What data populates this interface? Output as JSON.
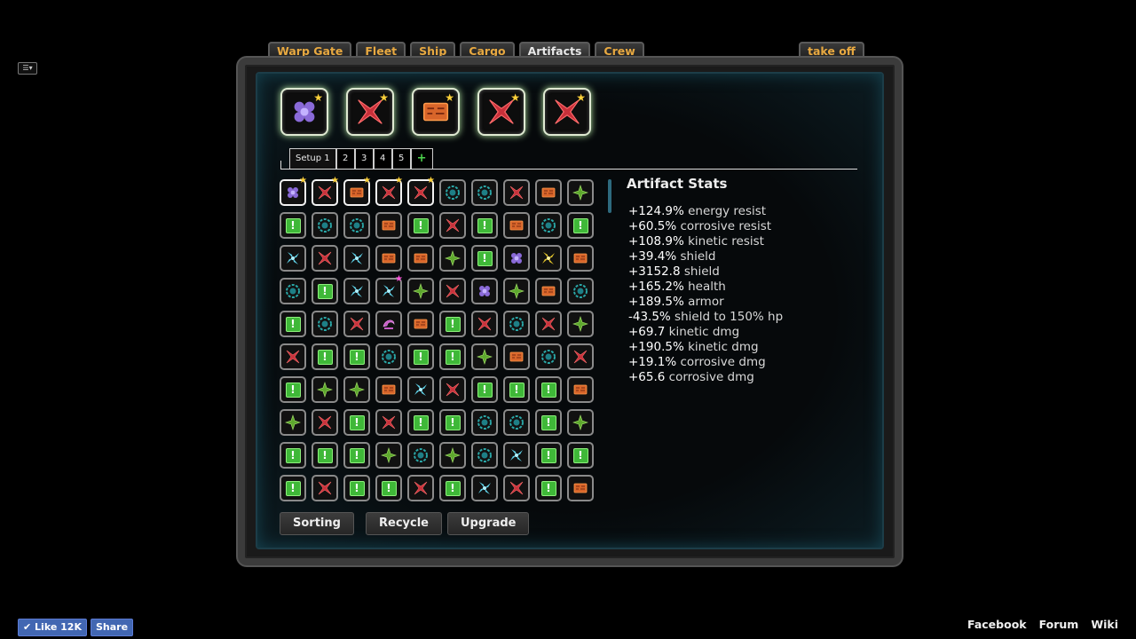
{
  "menu_icon": "menu-dropdown-icon",
  "tabs": [
    {
      "label": "Warp Gate",
      "active": false
    },
    {
      "label": "Fleet",
      "active": false
    },
    {
      "label": "Ship",
      "active": false
    },
    {
      "label": "Cargo",
      "active": false
    },
    {
      "label": "Artifacts",
      "active": true
    },
    {
      "label": "Crew",
      "active": false
    }
  ],
  "takeoff_label": "take off",
  "equipped": [
    "purple-hex",
    "red-x",
    "orange-chip",
    "red-x",
    "red-x"
  ],
  "setups": [
    {
      "label": "Setup 1",
      "active": true
    },
    {
      "label": "2",
      "active": false
    },
    {
      "label": "3",
      "active": false
    },
    {
      "label": "4",
      "active": false
    },
    {
      "label": "5",
      "active": false
    }
  ],
  "add_setup_label": "+",
  "grid": [
    [
      "purple-hex*",
      "red-x*",
      "orange-chip*",
      "red-x*",
      "red-x*",
      "teal-gear",
      "teal-gear",
      "red-x",
      "orange-chip",
      "green-leaf"
    ],
    [
      "green-box",
      "teal-gear",
      "teal-gear",
      "orange-chip",
      "green-box",
      "red-x",
      "green-box",
      "orange-chip",
      "teal-gear",
      "green-box"
    ],
    [
      "cyan-fan",
      "red-x",
      "cyan-fan",
      "orange-chip",
      "orange-chip",
      "green-leaf",
      "green-box",
      "purple-hex",
      "yellow-fan",
      "orange-chip"
    ],
    [
      "teal-gear",
      "green-box",
      "cyan-fan",
      "cyan-fan!",
      "green-leaf",
      "red-x",
      "purple-hex",
      "green-leaf",
      "orange-chip",
      "teal-gear"
    ],
    [
      "green-box",
      "teal-gear",
      "red-x",
      "pink-claw",
      "orange-chip",
      "green-box",
      "red-x",
      "teal-gear",
      "red-x",
      "green-leaf"
    ],
    [
      "red-x",
      "green-box",
      "green-box",
      "teal-gear",
      "green-box",
      "green-box",
      "green-leaf",
      "orange-chip",
      "teal-gear",
      "red-x"
    ],
    [
      "green-box",
      "green-leaf",
      "green-leaf",
      "orange-chip",
      "cyan-fan",
      "red-x",
      "green-box",
      "green-box",
      "green-box",
      "orange-chip"
    ],
    [
      "green-leaf",
      "red-x",
      "green-box",
      "red-x",
      "green-box",
      "green-box",
      "teal-gear",
      "teal-gear",
      "green-box",
      "green-leaf"
    ],
    [
      "green-box",
      "green-box",
      "green-box",
      "green-leaf",
      "teal-gear",
      "green-leaf",
      "teal-gear",
      "cyan-fan",
      "green-box",
      "green-box"
    ],
    [
      "green-box",
      "red-x",
      "green-box",
      "green-box",
      "red-x",
      "green-box",
      "cyan-fan",
      "red-x",
      "green-box",
      "orange-chip"
    ]
  ],
  "stats_title": "Artifact Stats",
  "stats": [
    {
      "value": "+124.9%",
      "label": "energy resist"
    },
    {
      "value": "+60.5%",
      "label": "corrosive resist"
    },
    {
      "value": "+108.9%",
      "label": "kinetic resist"
    },
    {
      "value": "+39.4%",
      "label": "shield"
    },
    {
      "value": "+3152.8",
      "label": "shield"
    },
    {
      "value": "+165.2%",
      "label": "health"
    },
    {
      "value": "+189.5%",
      "label": "armor"
    },
    {
      "value": "-43.5%",
      "label": "shield to 150% hp"
    },
    {
      "value": "+69.7",
      "label": "kinetic dmg"
    },
    {
      "value": "+190.5%",
      "label": "kinetic dmg"
    },
    {
      "value": "+19.1%",
      "label": "corrosive dmg"
    },
    {
      "value": "+65.6",
      "label": "corrosive dmg"
    }
  ],
  "buttons": {
    "sorting": "Sorting",
    "recycle": "Recycle",
    "upgrade": "Upgrade"
  },
  "footer": {
    "like": "Like 12K",
    "share": "Share",
    "links": [
      "Facebook",
      "Forum",
      "Wiki"
    ]
  },
  "colors": {
    "accent_tab": "#e8a941",
    "panel_border": "#1c3d48",
    "equip_glow": "#b5e6a5"
  }
}
